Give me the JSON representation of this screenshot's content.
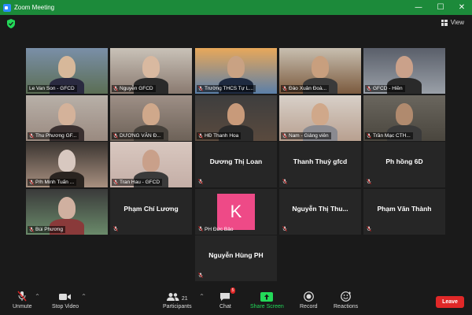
{
  "window": {
    "title": "Zoom Meeting",
    "minimize": "—",
    "maximize": "☐",
    "close": "✕"
  },
  "topbar": {
    "view_label": "View"
  },
  "participants_grid": [
    {
      "name": "Le Van Son - GFCD",
      "type": "video",
      "active": true,
      "muted": false
    },
    {
      "name": "Nguyễn GFCD",
      "type": "video",
      "muted": true
    },
    {
      "name": "Trường THCS Tự L...",
      "type": "video",
      "muted": true
    },
    {
      "name": "Đào Xuân Đoà...",
      "type": "video",
      "muted": true
    },
    {
      "name": "GFCD - Hiền",
      "type": "video",
      "muted": true
    },
    {
      "name": "Thu Phương GF...",
      "type": "video",
      "muted": true
    },
    {
      "name": "DƯƠNG VĂN Đ...",
      "type": "video",
      "muted": true
    },
    {
      "name": "HĐ Thanh Hoa",
      "type": "video",
      "muted": true
    },
    {
      "name": "Nam - Giảng viên",
      "type": "video",
      "muted": true
    },
    {
      "name": "Trần Mạc CTH...",
      "type": "video",
      "muted": true
    },
    {
      "name": "P/h Minh Tuấn ...",
      "type": "video",
      "muted": true
    },
    {
      "name": "Tran Hau - GFCD",
      "type": "video",
      "muted": true
    },
    {
      "name": "Dương Thị Loan",
      "type": "name",
      "muted": true
    },
    {
      "name": "Thanh Thuỷ gfcd",
      "type": "name",
      "muted": true
    },
    {
      "name": "Ph hồng 6D",
      "type": "name",
      "muted": true
    },
    {
      "name": "Bùi Phương",
      "type": "video",
      "muted": true
    },
    {
      "name": "Phạm Chí Lương",
      "type": "name",
      "muted": true
    },
    {
      "name": "PH Đức Bảo",
      "type": "avatar",
      "avatar_letter": "K",
      "avatar_color": "#ee4a87",
      "muted": true
    },
    {
      "name": "Nguyễn Thị Thu...",
      "type": "name",
      "muted": true
    },
    {
      "name": "Phạm Văn Thành",
      "type": "name",
      "muted": true
    },
    {
      "name": "Nguyễn Hùng PH",
      "type": "name",
      "muted": true
    }
  ],
  "toolbar": {
    "unmute": "Unmute",
    "stop_video": "Stop Video",
    "participants": "Participants",
    "participants_count": "21",
    "chat": "Chat",
    "chat_badge": "5",
    "share_screen": "Share Screen",
    "record": "Record",
    "reactions": "Reactions",
    "leave": "Leave"
  },
  "colors": {
    "titlebar": "#1c8a3a",
    "active_border": "#c6e03b",
    "share": "#23d959",
    "leave": "#e02828"
  }
}
